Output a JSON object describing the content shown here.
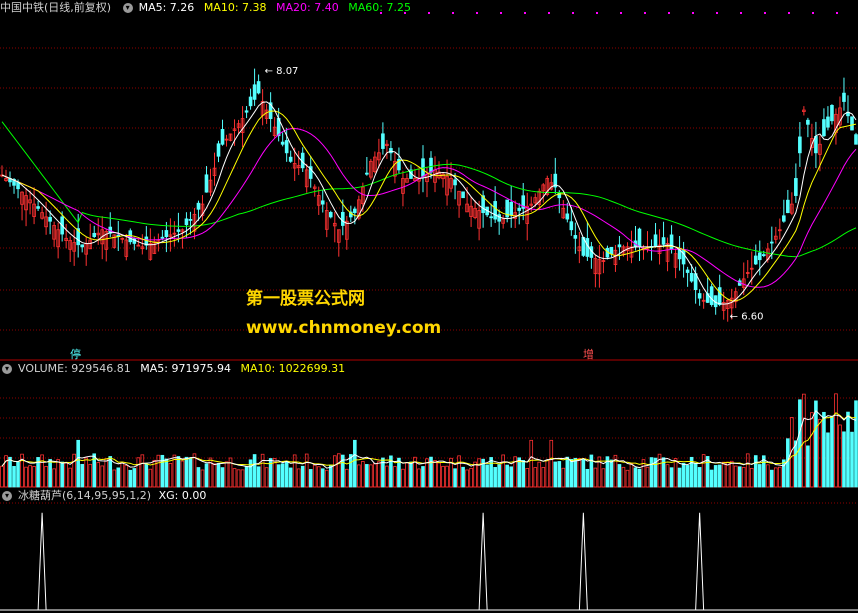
{
  "price_header": {
    "stock": "中国中铁",
    "mode": "(日线,前复权)",
    "ma5": "MA5: 7.26",
    "ma10": "MA10: 7.38",
    "ma20": "MA20: 7.40",
    "ma60": "MA60: 7.25"
  },
  "volume_header": {
    "volume": "VOLUME: 929546.81",
    "ma5": "MA5: 971975.94",
    "ma10": "MA10: 1022699.31"
  },
  "indicator_header": {
    "name": "冰糖葫芦(6,14,95,95,1,2)",
    "xg": "XG: 0.00"
  },
  "watermark": {
    "line1": "第一股票公式网",
    "line2": "www.chnmoney.com"
  },
  "markers": {
    "stop": "停",
    "increase": "增"
  },
  "colors": {
    "up": "#ff3232",
    "down": "#54ffff",
    "ma5": "#ffffff",
    "ma10": "#ffff00",
    "ma20": "#ff00ff",
    "ma60": "#00ff00",
    "grid": "#8b0000",
    "watermark": "#ffd700"
  },
  "chart_data": [
    {
      "type": "candlestick",
      "title": "中国中铁 (日线,前复权)",
      "annotations": [
        {
          "label": "8.07",
          "x": 64,
          "value": 8.07
        },
        {
          "label": "6.60",
          "x": 180,
          "value": 6.6
        }
      ],
      "series_names": [
        "MA5",
        "MA10",
        "MA20",
        "MA60"
      ],
      "grid": true,
      "ylim": [
        6.35,
        8.35
      ],
      "x_count": 214
    },
    {
      "type": "bar",
      "title": "VOLUME",
      "series_names": [
        "VOLUME",
        "MA5",
        "MA10"
      ],
      "grid": true
    },
    {
      "type": "line",
      "title": "冰糖葫芦(6,14,95,95,1,2)",
      "series_names": [
        "XG"
      ],
      "spikes_at_x": [
        10,
        120,
        145,
        174
      ],
      "spike_value": 1,
      "ylim": [
        0,
        1.1
      ]
    }
  ]
}
